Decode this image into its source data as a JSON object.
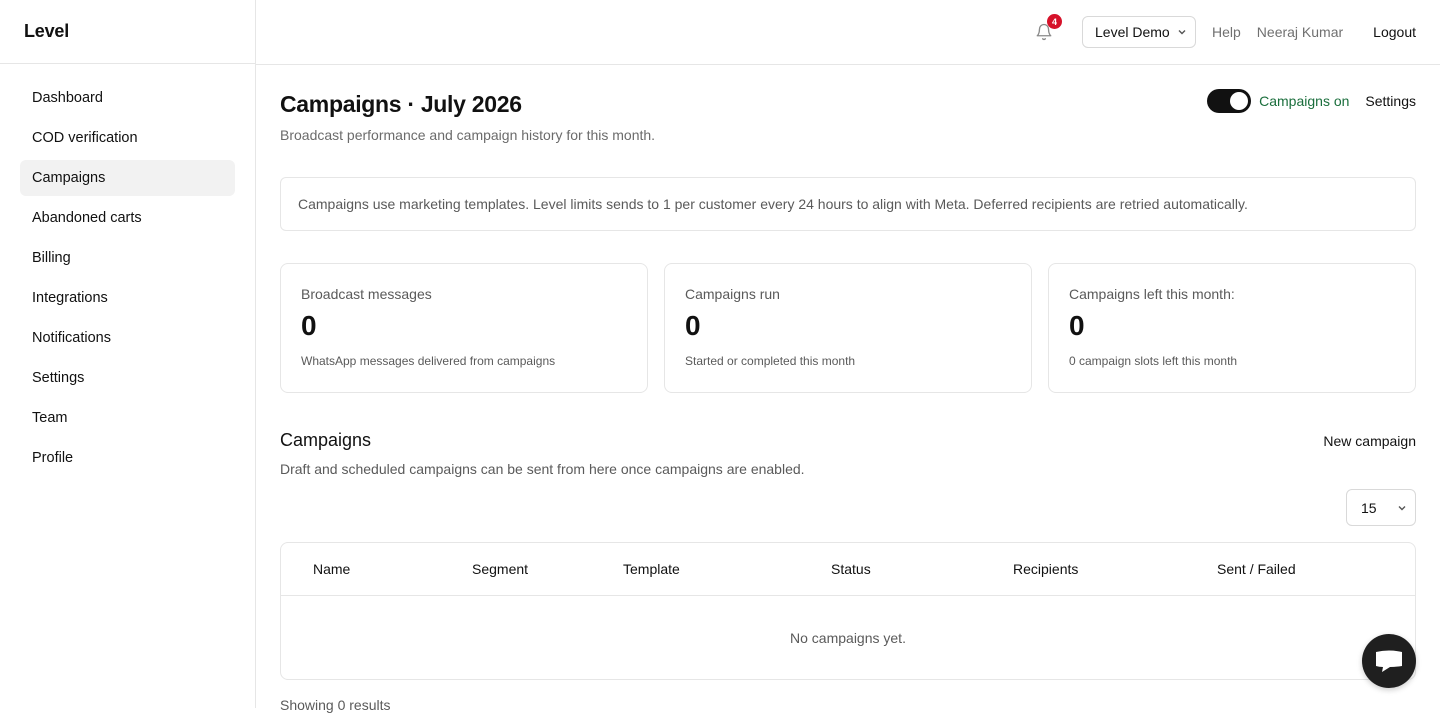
{
  "brand": "Level",
  "sidebar": {
    "items": [
      {
        "label": "Dashboard",
        "active": false
      },
      {
        "label": "COD verification",
        "active": false
      },
      {
        "label": "Campaigns",
        "active": true
      },
      {
        "label": "Abandoned carts",
        "active": false
      },
      {
        "label": "Billing",
        "active": false
      },
      {
        "label": "Integrations",
        "active": false
      },
      {
        "label": "Notifications",
        "active": false
      },
      {
        "label": "Settings",
        "active": false
      },
      {
        "label": "Team",
        "active": false
      },
      {
        "label": "Profile",
        "active": false
      }
    ]
  },
  "topbar": {
    "notification_count": "4",
    "store_select": "Level Demo",
    "help": "Help",
    "user": "Neeraj Kumar",
    "logout": "Logout"
  },
  "page": {
    "title": "Campaigns · July 2026",
    "subtitle": "Broadcast performance and campaign history for this month.",
    "toggle_label": "Campaigns on",
    "toggle_on": true,
    "settings": "Settings",
    "notice": "Campaigns use marketing templates. Level limits sends to 1 per customer every 24 hours to align with Meta. Deferred recipients are retried automatically."
  },
  "stats": [
    {
      "label": "Broadcast messages",
      "value": "0",
      "hint": "WhatsApp messages delivered from campaigns"
    },
    {
      "label": "Campaigns run",
      "value": "0",
      "hint": "Started or completed this month"
    },
    {
      "label": "Campaigns left this month:",
      "value": "0",
      "hint": "0 campaign slots left this month"
    }
  ],
  "campaigns": {
    "title": "Campaigns",
    "new_button": "New campaign",
    "subtitle": "Draft and scheduled campaigns can be sent from here once campaigns are enabled.",
    "page_size": "15",
    "columns": [
      "Name",
      "Segment",
      "Template",
      "Status",
      "Recipients",
      "Sent / Failed"
    ],
    "empty": "No campaigns yet.",
    "showing": "Showing 0 results"
  },
  "colors": {
    "accent_green": "#1a6e3c",
    "badge_red": "#d6122a",
    "toggle_dark": "#111111"
  },
  "icons": {
    "bell": "bell-icon",
    "chevron": "chevron-down-icon",
    "chat": "chat-icon"
  }
}
